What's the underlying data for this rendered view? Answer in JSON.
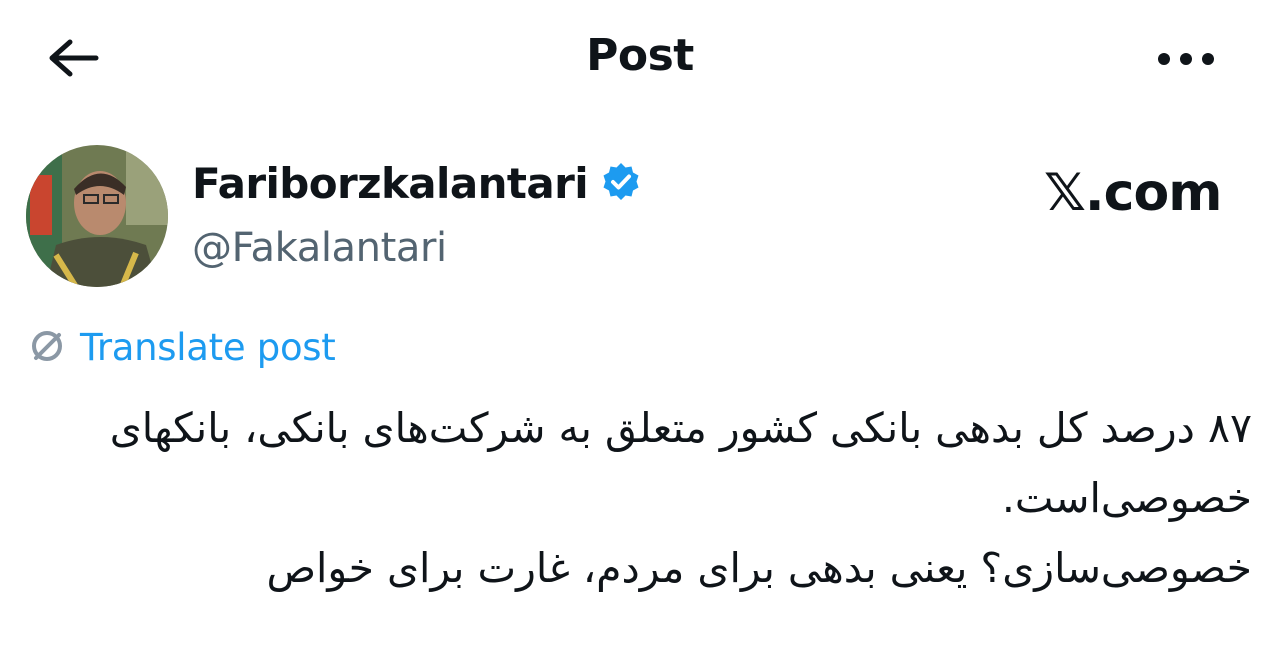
{
  "header": {
    "title": "Post",
    "back_icon": "arrow-left-icon",
    "more_icon": "more-horizontal-icon"
  },
  "author": {
    "display_name": "Fariborzkalantari",
    "handle": "@Fakalantari",
    "verified_icon": "verified-badge-icon",
    "verified_color": "#1d9bf0"
  },
  "watermark": {
    "text": "𝕏.com"
  },
  "translate": {
    "label": "Translate post",
    "icon": "globe-icon",
    "color": "#1d9bf0"
  },
  "post": {
    "text": "۸۷ درصد کل بدهی بانکی کشور متعلق به شرکت‌های بانکی، بانکهای خصوصی‌است.\nخصوصی‌سازی؟ یعنی بدهی برای مردم، غارت برای خواص"
  }
}
